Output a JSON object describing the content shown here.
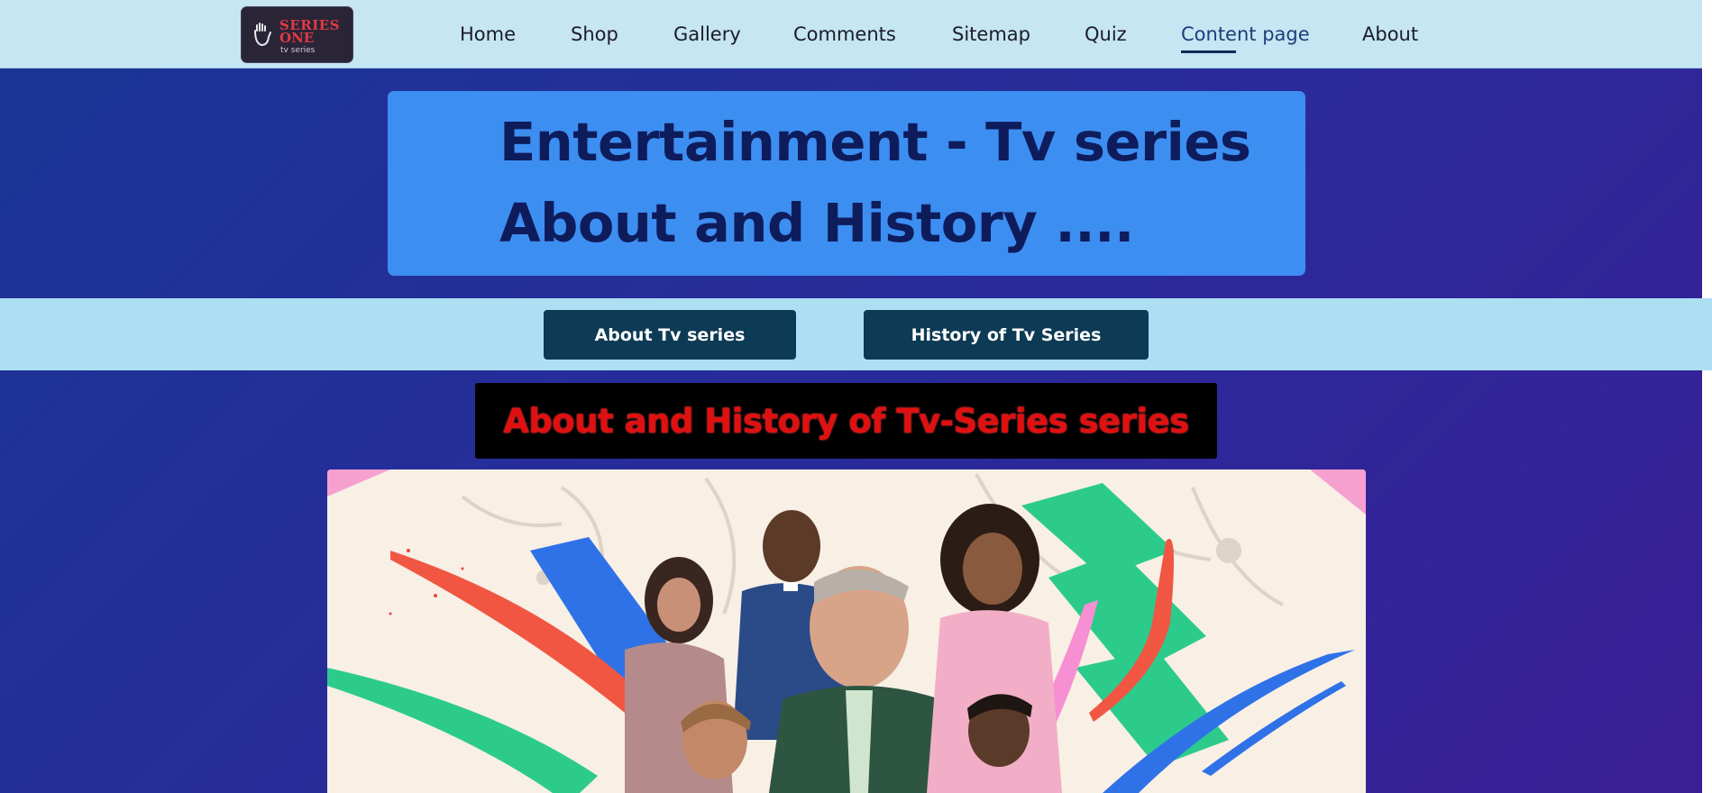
{
  "logo": {
    "line1": "SERIES",
    "line2": "ONE",
    "line3": "tv series"
  },
  "nav": {
    "items": [
      "Home",
      "Shop",
      "Gallery",
      "Comments",
      "Sitemap",
      "Quiz",
      "Content page",
      "About"
    ],
    "active": "Content page"
  },
  "hero": {
    "line1": "Entertainment - Tv series",
    "line2": "About and History ...."
  },
  "buttons": {
    "about": "About Tv series",
    "history": "History of Tv Series"
  },
  "section_title": "About and History of Tv-Series series",
  "colors": {
    "navbar": "#c5e6f2",
    "hero": "#3d8ef1",
    "hero_text": "#0e1c5c",
    "button": "#0d3a55",
    "band": "#addff3",
    "title_text": "#e11010"
  }
}
